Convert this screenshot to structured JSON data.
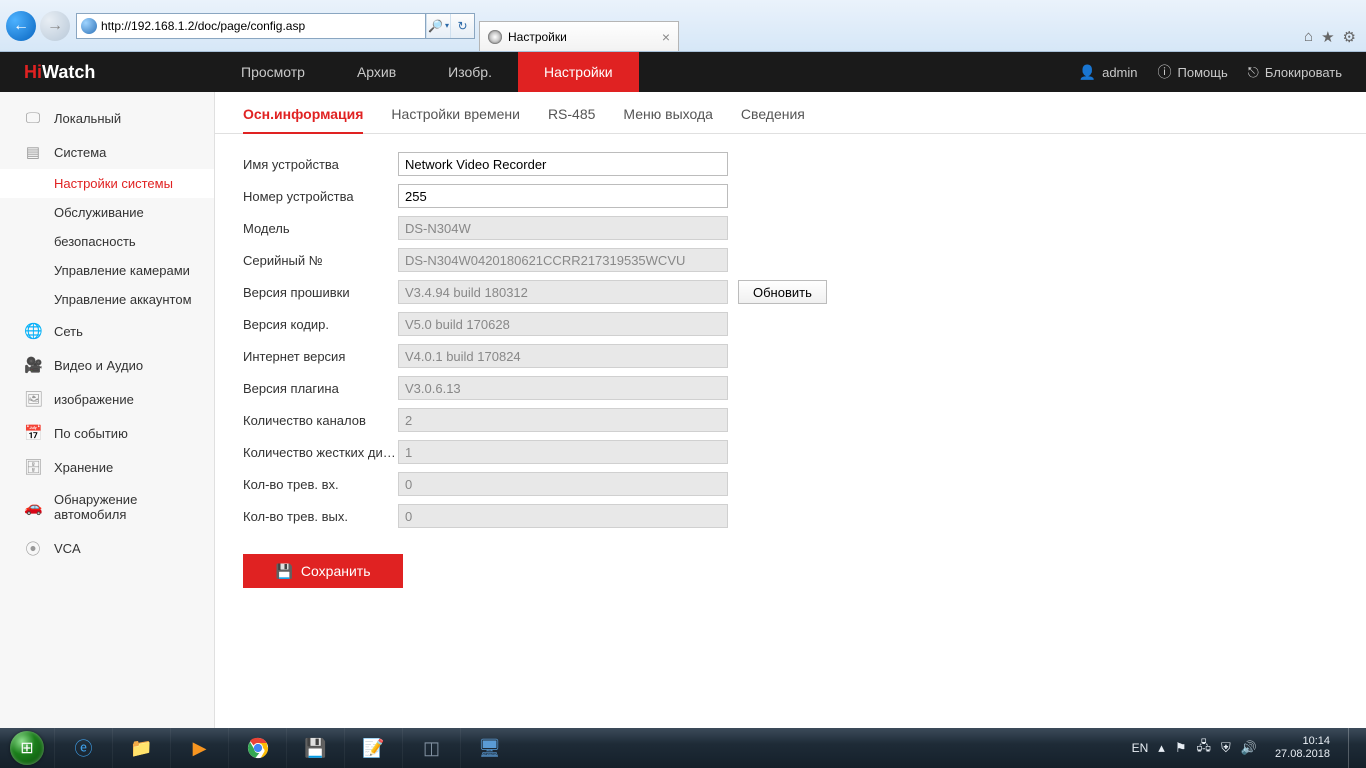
{
  "browser": {
    "url": "http://192.168.1.2/doc/page/config.asp",
    "tab_title": "Настройки"
  },
  "brand": {
    "accent": "Hi",
    "rest": "Watch"
  },
  "top_nav": {
    "items": [
      "Просмотр",
      "Архив",
      "Изобр.",
      "Настройки"
    ],
    "active_index": 3
  },
  "user_menu": {
    "username": "admin",
    "help": "Помощь",
    "lock": "Блокировать"
  },
  "sidebar": {
    "items": [
      {
        "label": "Локальный"
      },
      {
        "label": "Система",
        "children": [
          {
            "label": "Настройки системы",
            "active": true
          },
          {
            "label": "Обслуживание"
          },
          {
            "label": "безопасность"
          },
          {
            "label": "Управление камерами"
          },
          {
            "label": "Управление аккаунтом"
          }
        ]
      },
      {
        "label": "Сеть"
      },
      {
        "label": "Видео и Аудио"
      },
      {
        "label": "изображение"
      },
      {
        "label": "По событию"
      },
      {
        "label": "Хранение"
      },
      {
        "label": "Обнаружение автомобиля"
      },
      {
        "label": "VCA"
      }
    ]
  },
  "tabs": {
    "items": [
      "Осн.информация",
      "Настройки времени",
      "RS-485",
      "Меню выхода",
      "Сведения"
    ],
    "active_index": 0
  },
  "form": {
    "device_name": {
      "label": "Имя устройства",
      "value": "Network Video Recorder",
      "readonly": false
    },
    "device_no": {
      "label": "Номер устройства",
      "value": "255",
      "readonly": false
    },
    "model": {
      "label": "Модель",
      "value": "DS-N304W",
      "readonly": true
    },
    "serial": {
      "label": "Серийный №",
      "value": "DS-N304W0420180621CCRR217319535WCVU",
      "readonly": true
    },
    "firmware": {
      "label": "Версия прошивки",
      "value": "V3.4.94 build 180312",
      "readonly": true,
      "action": "Обновить"
    },
    "encoding": {
      "label": "Версия кодир.",
      "value": "V5.0 build 170628",
      "readonly": true
    },
    "web": {
      "label": "Интернет версия",
      "value": "V4.0.1 build 170824",
      "readonly": true
    },
    "plugin": {
      "label": "Версия плагина",
      "value": "V3.0.6.13",
      "readonly": true
    },
    "channels": {
      "label": "Количество каналов",
      "value": "2",
      "readonly": true
    },
    "hdds": {
      "label": "Количество жестких дис...",
      "value": "1",
      "readonly": true
    },
    "alarm_in": {
      "label": "Кол-во трев. вх.",
      "value": "0",
      "readonly": true
    },
    "alarm_out": {
      "label": "Кол-во трев. вых.",
      "value": "0",
      "readonly": true
    }
  },
  "buttons": {
    "save": "Сохранить"
  },
  "taskbar": {
    "lang": "EN",
    "time": "10:14",
    "date": "27.08.2018"
  }
}
